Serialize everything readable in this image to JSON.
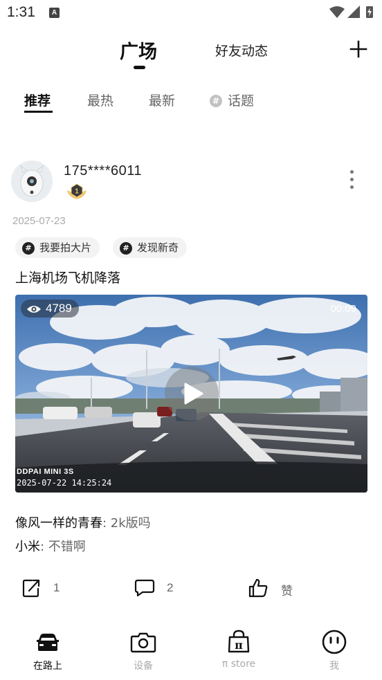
{
  "status_bar": {
    "time": "1:31",
    "notification_letter": "A"
  },
  "top_nav": {
    "tabs": [
      {
        "label": "广场",
        "active": true
      },
      {
        "label": "好友动态",
        "active": false
      }
    ],
    "add_icon": "plus-icon"
  },
  "sub_tabs": [
    {
      "label": "推荐",
      "active": true
    },
    {
      "label": "最热",
      "active": false
    },
    {
      "label": "最新",
      "active": false
    },
    {
      "label": "话题",
      "active": false,
      "icon": "hash-circle-icon"
    }
  ],
  "post": {
    "username": "175****6011",
    "level": "1",
    "date": "2025-07-23",
    "tags": [
      {
        "label": "我要拍大片"
      },
      {
        "label": "发现新奇"
      }
    ],
    "title": "上海机场飞机降落",
    "video": {
      "views": "4789",
      "duration": "00:09",
      "watermark_brand": "DDPAI MINI 3S",
      "watermark_time": "2025-07-22 14:25:24"
    },
    "comments": [
      {
        "author": "像风一样的青春",
        "separator": ": ",
        "text": "2k版吗"
      },
      {
        "author": "小米",
        "separator": ": ",
        "text": "不错啊"
      }
    ],
    "actions": {
      "share_count": "1",
      "comment_count": "2",
      "like_label": "赞"
    }
  },
  "bottom_nav": [
    {
      "label": "在路上",
      "icon": "car-icon",
      "active": true
    },
    {
      "label": "设备",
      "icon": "camera-icon",
      "active": false
    },
    {
      "label": "π store",
      "icon": "store-bag-icon",
      "active": false
    },
    {
      "label": "我",
      "icon": "face-icon",
      "active": false
    }
  ],
  "colors": {
    "primary_text": "#111111",
    "secondary_text": "#666666",
    "muted_text": "#aaaaaa",
    "tag_background": "#f3f3f3"
  }
}
